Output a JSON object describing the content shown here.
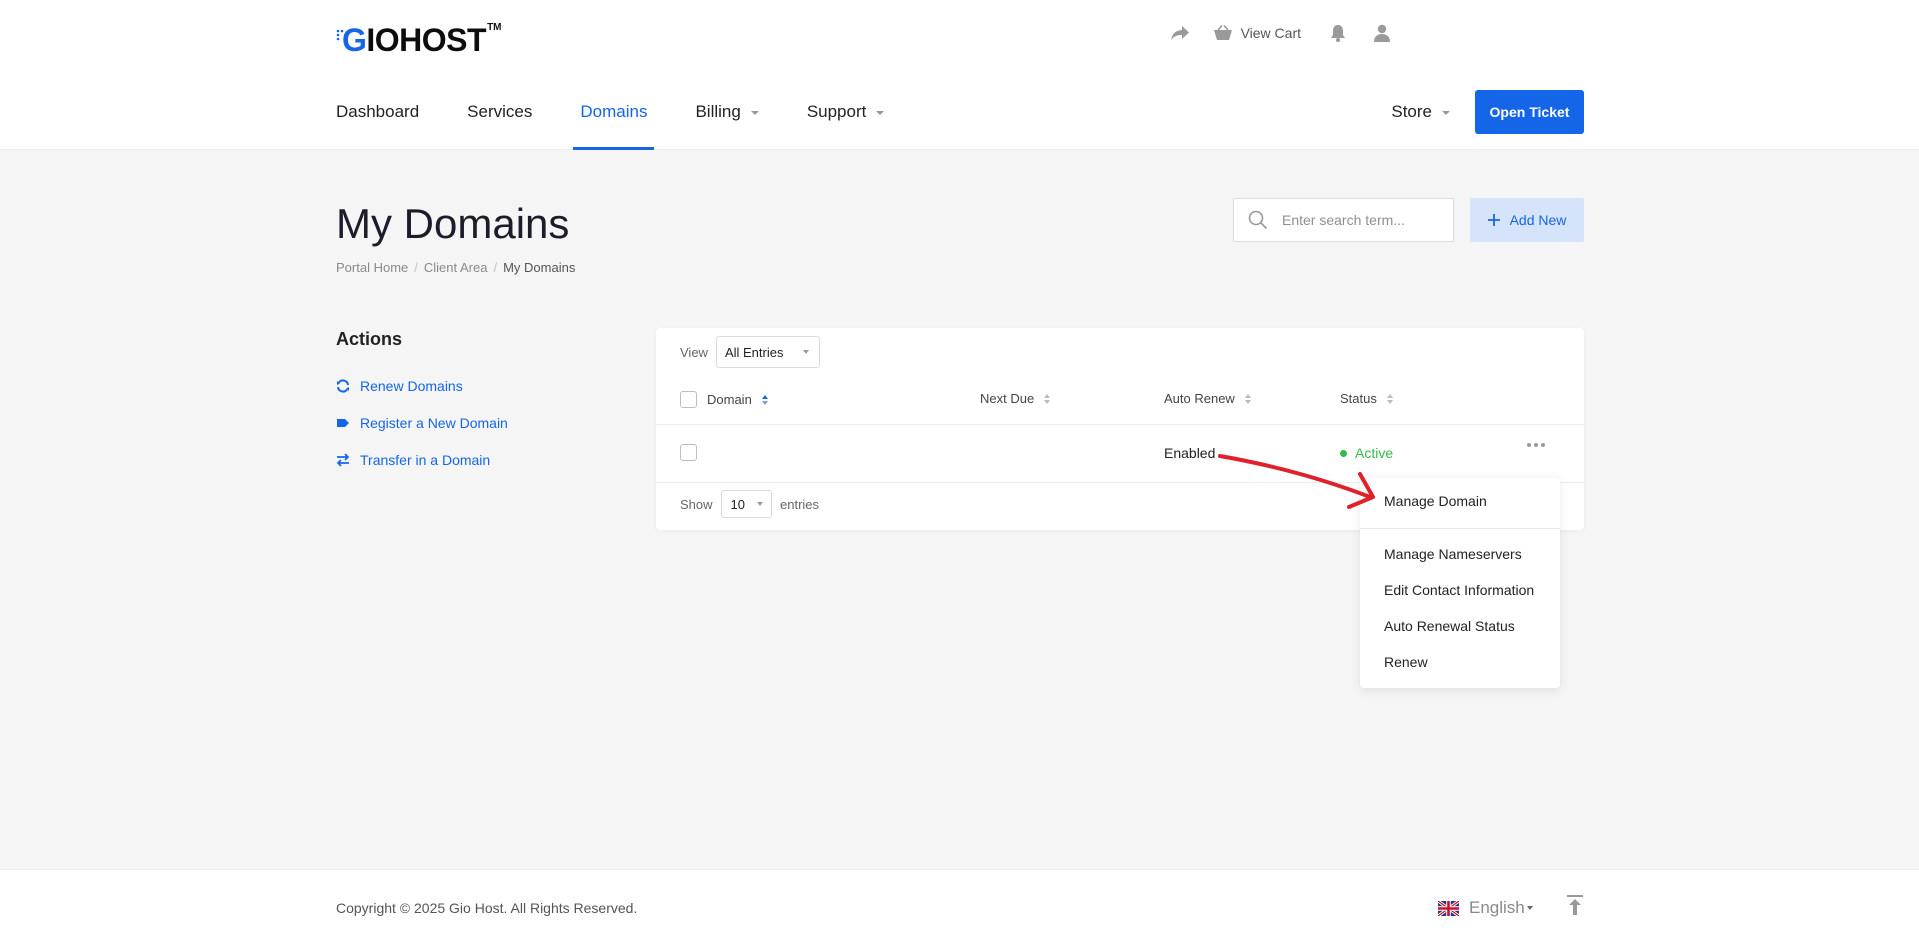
{
  "brand": {
    "logo_main": "IOHOST",
    "logo_g": "G",
    "logo_tm": "TM",
    "brand_color": "#1565e8"
  },
  "top_actions": {
    "share_icon": "share-icon",
    "view_cart_label": "View Cart",
    "cart_icon": "basket-icon",
    "bell_icon": "bell-icon",
    "user_icon": "user-icon"
  },
  "nav": {
    "items": [
      {
        "label": "Dashboard",
        "active": false,
        "has_caret": false
      },
      {
        "label": "Services",
        "active": false,
        "has_caret": false
      },
      {
        "label": "Domains",
        "active": true,
        "has_caret": false
      },
      {
        "label": "Billing",
        "active": false,
        "has_caret": true
      },
      {
        "label": "Support",
        "active": false,
        "has_caret": true
      }
    ],
    "store_label": "Store",
    "open_ticket_label": "Open Ticket"
  },
  "page": {
    "title": "My Domains",
    "breadcrumb": [
      "Portal Home",
      "Client Area",
      "My Domains"
    ],
    "search_placeholder": "Enter search term...",
    "add_new_label": "Add New"
  },
  "sidebar": {
    "title": "Actions",
    "links": [
      {
        "label": "Renew Domains",
        "icon": "sync-icon"
      },
      {
        "label": "Register a New Domain",
        "icon": "tag-icon"
      },
      {
        "label": "Transfer in a Domain",
        "icon": "exchange-icon"
      }
    ]
  },
  "table": {
    "view_label": "View",
    "view_value": "All Entries",
    "columns": [
      "Domain",
      "Next Due",
      "Auto Renew",
      "Status"
    ],
    "rows": [
      {
        "domain": "",
        "next_due": "",
        "auto_renew": "Enabled",
        "status": "Active"
      }
    ],
    "show_label": "Show",
    "show_value": "10",
    "entries_label": "entries",
    "status_color": "#36b84b"
  },
  "row_menu": {
    "items": [
      "Manage Domain",
      "Manage Nameservers",
      "Edit Contact Information",
      "Auto Renewal Status",
      "Renew"
    ]
  },
  "footer": {
    "copyright": "Copyright © 2025 Gio Host. All Rights Reserved.",
    "language": "English",
    "flag_icon": "uk-flag-icon",
    "back_to_top_icon": "arrow-up-icon"
  },
  "annotation": {
    "arrow_color": "#e0202a"
  }
}
